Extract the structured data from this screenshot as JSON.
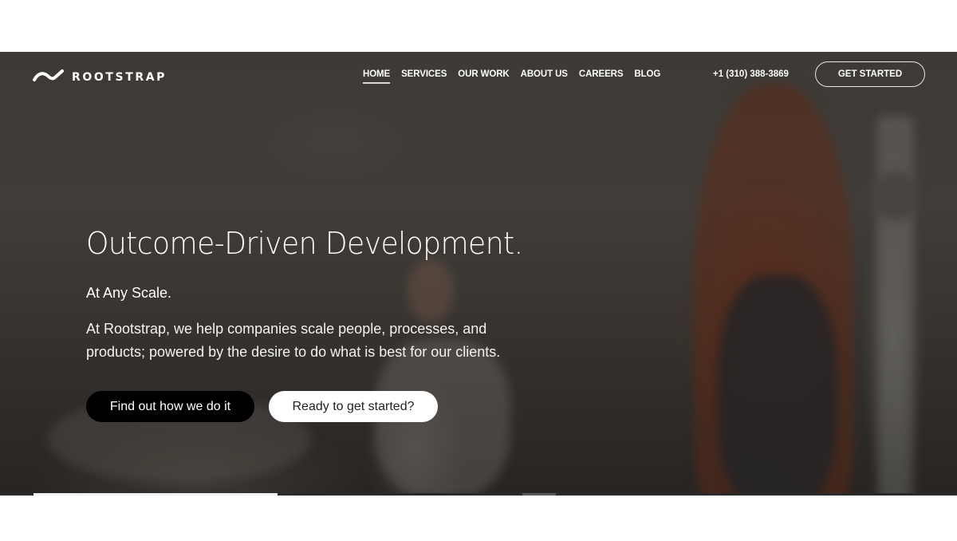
{
  "brand": {
    "name": "ROOTSTRAP",
    "logo_icon": "wave-check-icon"
  },
  "nav": {
    "items": [
      {
        "label": "HOME",
        "active": true
      },
      {
        "label": "SERVICES",
        "active": false
      },
      {
        "label": "OUR WORK",
        "active": false
      },
      {
        "label": "ABOUT US",
        "active": false
      },
      {
        "label": "CAREERS",
        "active": false
      },
      {
        "label": "BLOG",
        "active": false
      }
    ],
    "phone": "+1 (310) 388-3869",
    "cta_label": "GET STARTED"
  },
  "hero": {
    "headline": "Outcome-Driven Development.",
    "subhead": "At Any Scale.",
    "body": "At Rootstrap, we help companies scale people, processes, and products; powered by the desire to do what is best for our clients.",
    "primary_button": "Find out how we do it",
    "secondary_button": "Ready to get started?"
  },
  "slider": {
    "progress_fraction": 0.255
  },
  "colors": {
    "primary_button_bg": "#000000",
    "secondary_button_bg": "#ffffff",
    "text": "#ffffff"
  }
}
